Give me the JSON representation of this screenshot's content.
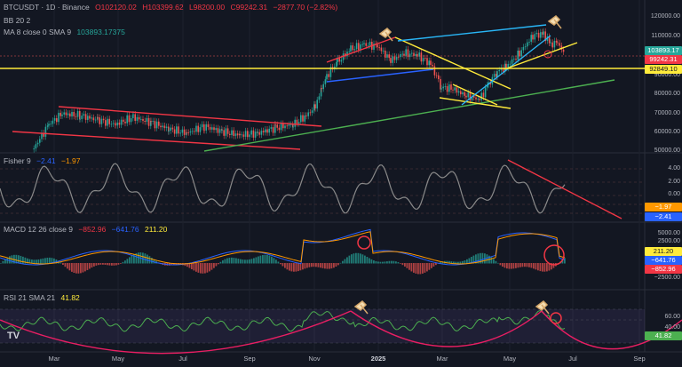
{
  "header": {
    "symbol": "BTCUSDT · 1D · Binance",
    "open": "O102120.02",
    "high": "H103399.62",
    "low": "L98200.00",
    "close": "C99242.31",
    "change": "−2877.70 (−2.82%)"
  },
  "indicators": {
    "bb": "BB 20 2",
    "ma": {
      "label": "MA 8 close 0 SMA 9",
      "value": "103893.17375"
    },
    "fisher": {
      "label": "Fisher 9",
      "v1": "−2.41",
      "v2": "−1.97"
    },
    "macd": {
      "label": "MACD 12 26 close 9",
      "v1": "−852.96",
      "v2": "−641.76",
      "v3": "211.20"
    },
    "rsi": {
      "label": "RSI 21 SMA 21",
      "value": "41.82"
    }
  },
  "price_tags": {
    "ma": "103893.17",
    "last": "99242.31",
    "level": "92849.10"
  },
  "colors": {
    "bg": "#131722",
    "candle_up": "#26a69a",
    "candle_down": "#ef5350",
    "channel": "#f23645",
    "yellow": "#ffeb3b",
    "blue": "#2962ff",
    "cyan": "#29b6f6",
    "green": "#4caf50",
    "macd": "#2962ff",
    "signal": "#ff9800",
    "rsi": "#4caf50",
    "arc": "#e91e63"
  },
  "chart_data": [
    {
      "type": "candlestick",
      "title": "BTCUSDT 1D",
      "ylim": [
        50000,
        125000
      ],
      "y_ticks": [
        "120000.00",
        "110000.00",
        "90000.00",
        "80000.00",
        "70000.00",
        "60000.00",
        "50000.00"
      ],
      "x_ticks": [
        "Mar",
        "May",
        "Jul",
        "Sep",
        "Nov",
        "2025",
        "Mar",
        "May",
        "Jul",
        "Sep"
      ],
      "last_price": 99242.31,
      "horizontal_level": 92849.1
    },
    {
      "type": "line",
      "title": "Fisher 9",
      "ylim": [
        -4,
        4
      ],
      "y_ticks": [
        "4.00",
        "2.00",
        "0.00"
      ],
      "last": [
        -2.41,
        -1.97
      ]
    },
    {
      "type": "line",
      "title": "MACD 12 26 close 9",
      "ylim": [
        -3000,
        6500
      ],
      "y_ticks": [
        "5000.00",
        "2500.00",
        "−2500.00"
      ],
      "last": {
        "macd": -641.76,
        "signal": -852.96,
        "hist": 211.2
      }
    },
    {
      "type": "line",
      "title": "RSI 21 SMA 21",
      "ylim": [
        20,
        80
      ],
      "y_ticks": [
        "60.00",
        "40.00"
      ],
      "last": 41.82
    }
  ],
  "logo": "TV"
}
